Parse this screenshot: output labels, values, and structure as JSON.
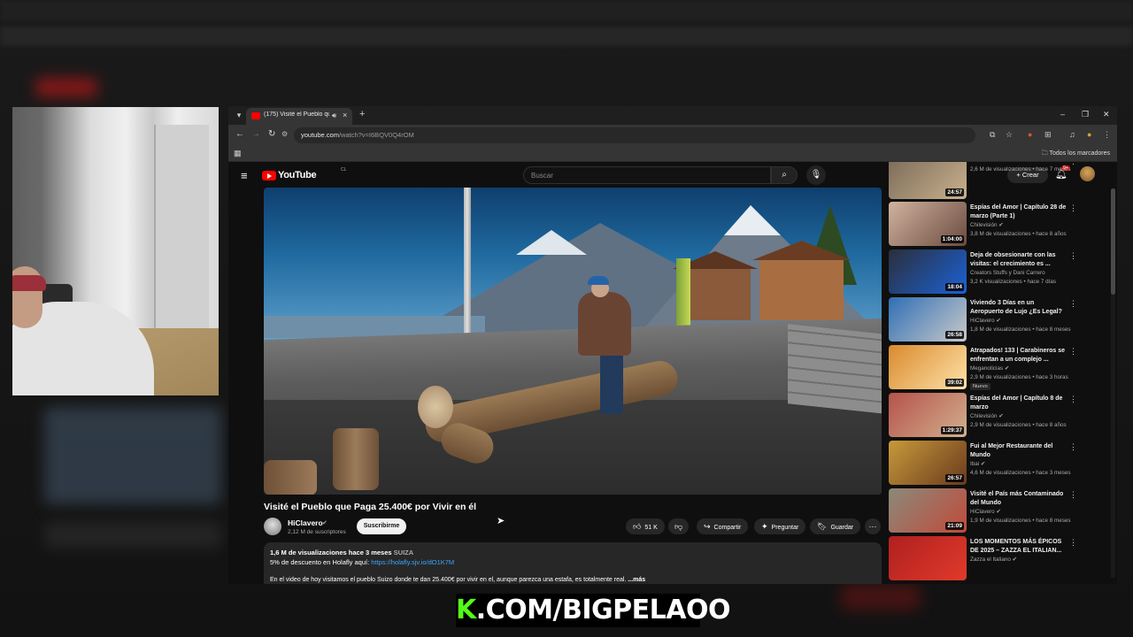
{
  "browser": {
    "tab_title": "(175) Visité el Pueblo que P",
    "url_host": "youtube.com",
    "url_path": "/watch?v=I6BQV0Q4rOM",
    "bookmarks_label": "Todos los marcadores",
    "minimize": "–",
    "restore": "❐",
    "close": "✕"
  },
  "youtube": {
    "logo": "YouTube",
    "logo_country": "CL",
    "search_placeholder": "Buscar",
    "create_label": "Crear",
    "notif_count": "9+"
  },
  "video": {
    "title": "Visité el Pueblo que Paga 25.400€ por Vivir en él",
    "channel": "HiClavero",
    "subscribers": "2,12 M de suscriptores",
    "subscribe_label": "Suscribirme",
    "likes": "51 K",
    "share_label": "Compartir",
    "ask_label": "Preguntar",
    "save_label": "Guardar",
    "description": {
      "stats": "1,6 M de visualizaciones  hace 3 meses",
      "tag": "SUIZA",
      "promo_text": "5% de descuento en Holafly aquí: ",
      "promo_link": "https://holafly.sjv.io/dO1K7M",
      "body": "En el video de hoy visitamos el pueblo Suizo donde te dan 25.400€ por vivir en el, aunque parezca una estafa, es totalmente real.",
      "more": "...más"
    }
  },
  "recommendations": [
    {
      "title": "",
      "channel": "HiClavero ✔",
      "meta": "2,6 M de visualizaciones • hace 7 meses",
      "duration": "24:57",
      "colors": [
        "#7a6a58",
        "#c9b18d"
      ]
    },
    {
      "title": "Espías del Amor | Capítulo 28 de marzo (Parte 1)",
      "channel": "Chilevisión ✔",
      "meta": "3,8 M de visualizaciones • hace 8 años",
      "duration": "1:04:00",
      "colors": [
        "#d1b3a0",
        "#6a4b3f"
      ]
    },
    {
      "title": "Deja de obsesionarte con las visitas: el crecimiento es ...",
      "channel": "Creators Stuffs y Dani Carrero",
      "meta": "3,2 K visualizaciones • hace 7 días",
      "duration": "18:04",
      "colors": [
        "#2a2f3a",
        "#1c61d6"
      ]
    },
    {
      "title": "Viviendo 3 Días en un Aeropuerto de Lujo ¿Es Legal?",
      "channel": "HiClavero ✔",
      "meta": "1,8 M de visualizaciones • hace 8 meses",
      "duration": "26:58",
      "colors": [
        "#2f6fb5",
        "#c9c9c9"
      ]
    },
    {
      "title": "Atrapados! 133 | Carabineros se enfrentan a un complejo ...",
      "channel": "Meganoticias ✔",
      "meta": "2,9 M de visualizaciones • hace 3 horas",
      "duration": "39:02",
      "badge": "Nuevo",
      "colors": [
        "#d98a2e",
        "#ffe2a8"
      ]
    },
    {
      "title": "Espías del Amor | Capítulo 8 de marzo",
      "channel": "Chilevisión ✔",
      "meta": "2,9 M de visualizaciones • hace 8 años",
      "duration": "1:29:37",
      "colors": [
        "#b5524a",
        "#d2b08e"
      ]
    },
    {
      "title": "Fui al Mejor Restaurante del Mundo",
      "channel": "Ibai ✔",
      "meta": "4,6 M de visualizaciones • hace 3 meses",
      "duration": "26:57",
      "colors": [
        "#c79a3a",
        "#6a3a1e"
      ]
    },
    {
      "title": "Visité el País más Contaminado del Mundo",
      "channel": "HiClavero ✔",
      "meta": "1,9 M de visualizaciones • hace 8 meses",
      "duration": "21:09",
      "colors": [
        "#8a8a7a",
        "#c24a3a"
      ]
    },
    {
      "title": "LOS MOMENTOS MÁS ÉPICOS DE 2025 – ZAZZA EL ITALIAN...",
      "channel": "Zazza el Italiano ✔",
      "meta": "",
      "duration": "",
      "colors": [
        "#b02020",
        "#e03a2a"
      ]
    }
  ],
  "overlay": {
    "k": "K",
    "rest": ".COM/BIGPELAOO"
  }
}
